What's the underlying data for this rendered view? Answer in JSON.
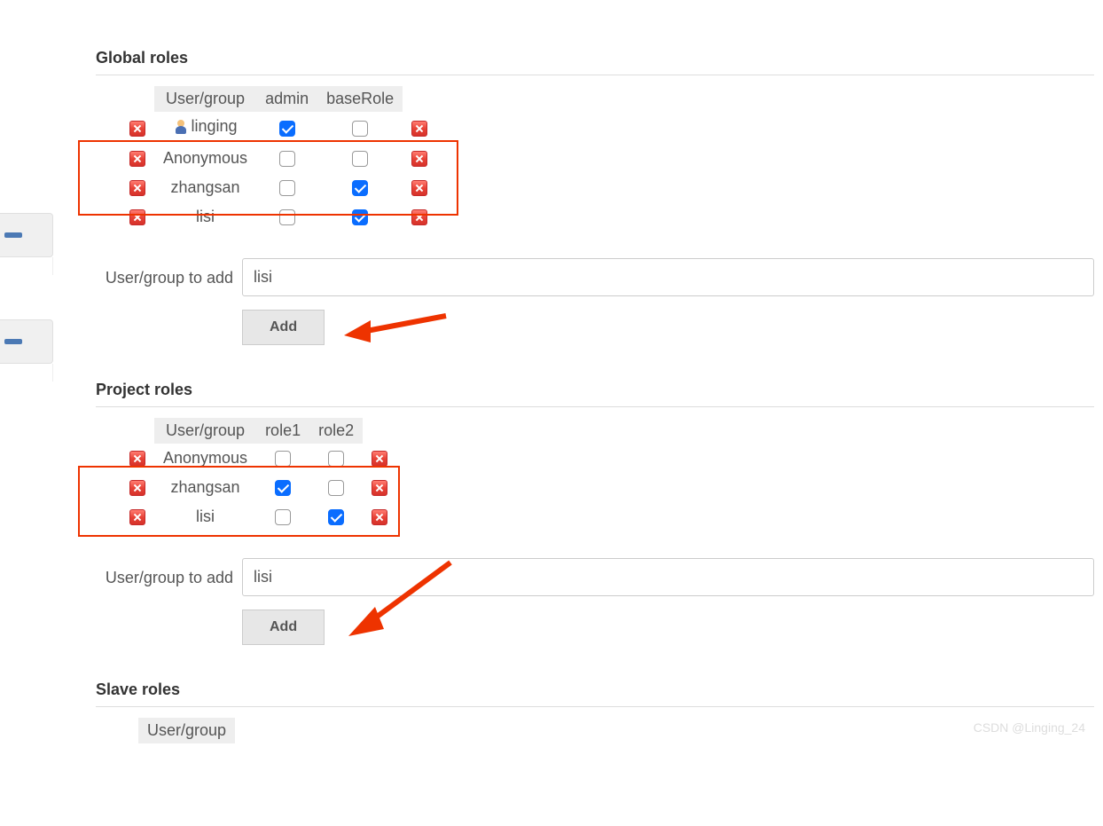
{
  "watermark": "CSDN @Linging_24",
  "globalRoles": {
    "title": "Global roles",
    "headers": {
      "userGroup": "User/group",
      "col1": "admin",
      "col2": "baseRole"
    },
    "rows": [
      {
        "hasPerson": true,
        "user": "linging",
        "c1": true,
        "c2": false
      },
      {
        "hasPerson": false,
        "user": "Anonymous",
        "c1": false,
        "c2": false
      },
      {
        "hasPerson": false,
        "user": "zhangsan",
        "c1": false,
        "c2": true
      },
      {
        "hasPerson": false,
        "user": "lisi",
        "c1": false,
        "c2": true
      }
    ],
    "add": {
      "label": "User/group to add",
      "value": "lisi",
      "button": "Add"
    }
  },
  "projectRoles": {
    "title": "Project roles",
    "headers": {
      "userGroup": "User/group",
      "col1": "role1",
      "col2": "role2"
    },
    "rows": [
      {
        "user": "Anonymous",
        "c1": false,
        "c2": false
      },
      {
        "user": "zhangsan",
        "c1": true,
        "c2": false
      },
      {
        "user": "lisi",
        "c1": false,
        "c2": true
      }
    ],
    "add": {
      "label": "User/group to add",
      "value": "lisi",
      "button": "Add"
    }
  },
  "slaveRoles": {
    "title": "Slave roles",
    "headers": {
      "userGroup": "User/group"
    }
  }
}
